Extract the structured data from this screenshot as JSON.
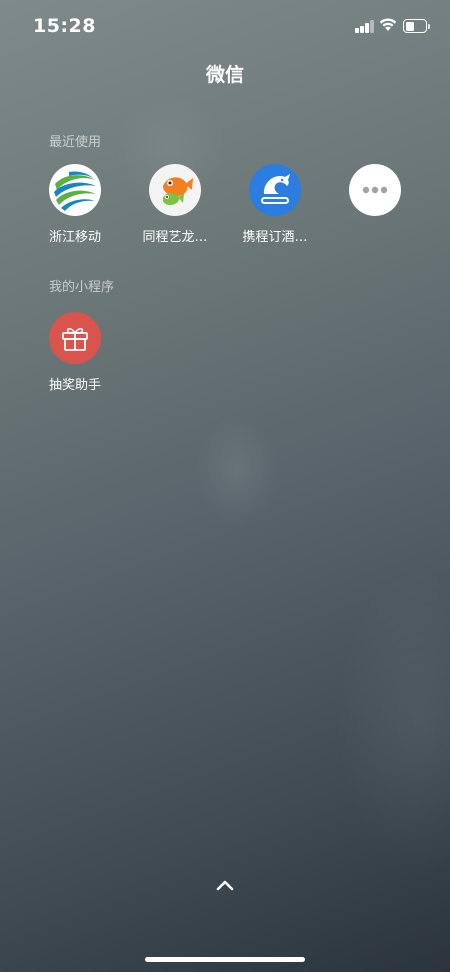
{
  "status_bar": {
    "time": "15:28",
    "signal_icon": "cellular-signal-icon",
    "wifi_icon": "wifi-icon",
    "battery_icon": "battery-icon",
    "battery_level": 0.35
  },
  "header": {
    "title": "微信"
  },
  "recent": {
    "section_label": "最近使用",
    "items": [
      {
        "label": "浙江移动",
        "icon": "china-mobile-logo-icon"
      },
      {
        "label": "同程艺龙…",
        "icon": "tongcheng-fish-logo-icon"
      },
      {
        "label": "携程订酒…",
        "icon": "ctrip-dolphin-logo-icon"
      },
      {
        "label": "",
        "icon": "more-dots-icon"
      }
    ]
  },
  "mine": {
    "section_label": "我的小程序",
    "items": [
      {
        "label": "抽奖助手",
        "icon": "gift-icon"
      }
    ]
  },
  "footer": {
    "collapse_icon": "chevron-up-icon"
  },
  "colors": {
    "gift_bg": "#d9544d",
    "ctrip_bg": "#2c7de0",
    "china_mobile_green": "#5db03f",
    "china_mobile_blue": "#1686c9"
  }
}
